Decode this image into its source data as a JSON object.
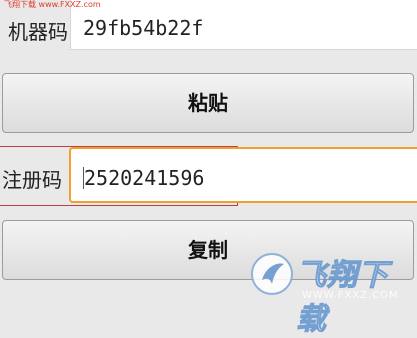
{
  "watermark_top": "飞翔下载 www.FXXZ.com",
  "machine_code": {
    "label": "机器码",
    "value": "29fb54b22f"
  },
  "paste_button": {
    "label": "粘贴"
  },
  "register_code": {
    "label": "注册码",
    "value": "2520241596"
  },
  "copy_button": {
    "label": "复制"
  },
  "watermark_badge": {
    "brand": "飞翔下载",
    "url": "WWW.FXXZ.COM"
  },
  "colors": {
    "focus_border": "#f0a030",
    "highlight_box": "#c04040",
    "watermark_text": "#e03a2d"
  }
}
